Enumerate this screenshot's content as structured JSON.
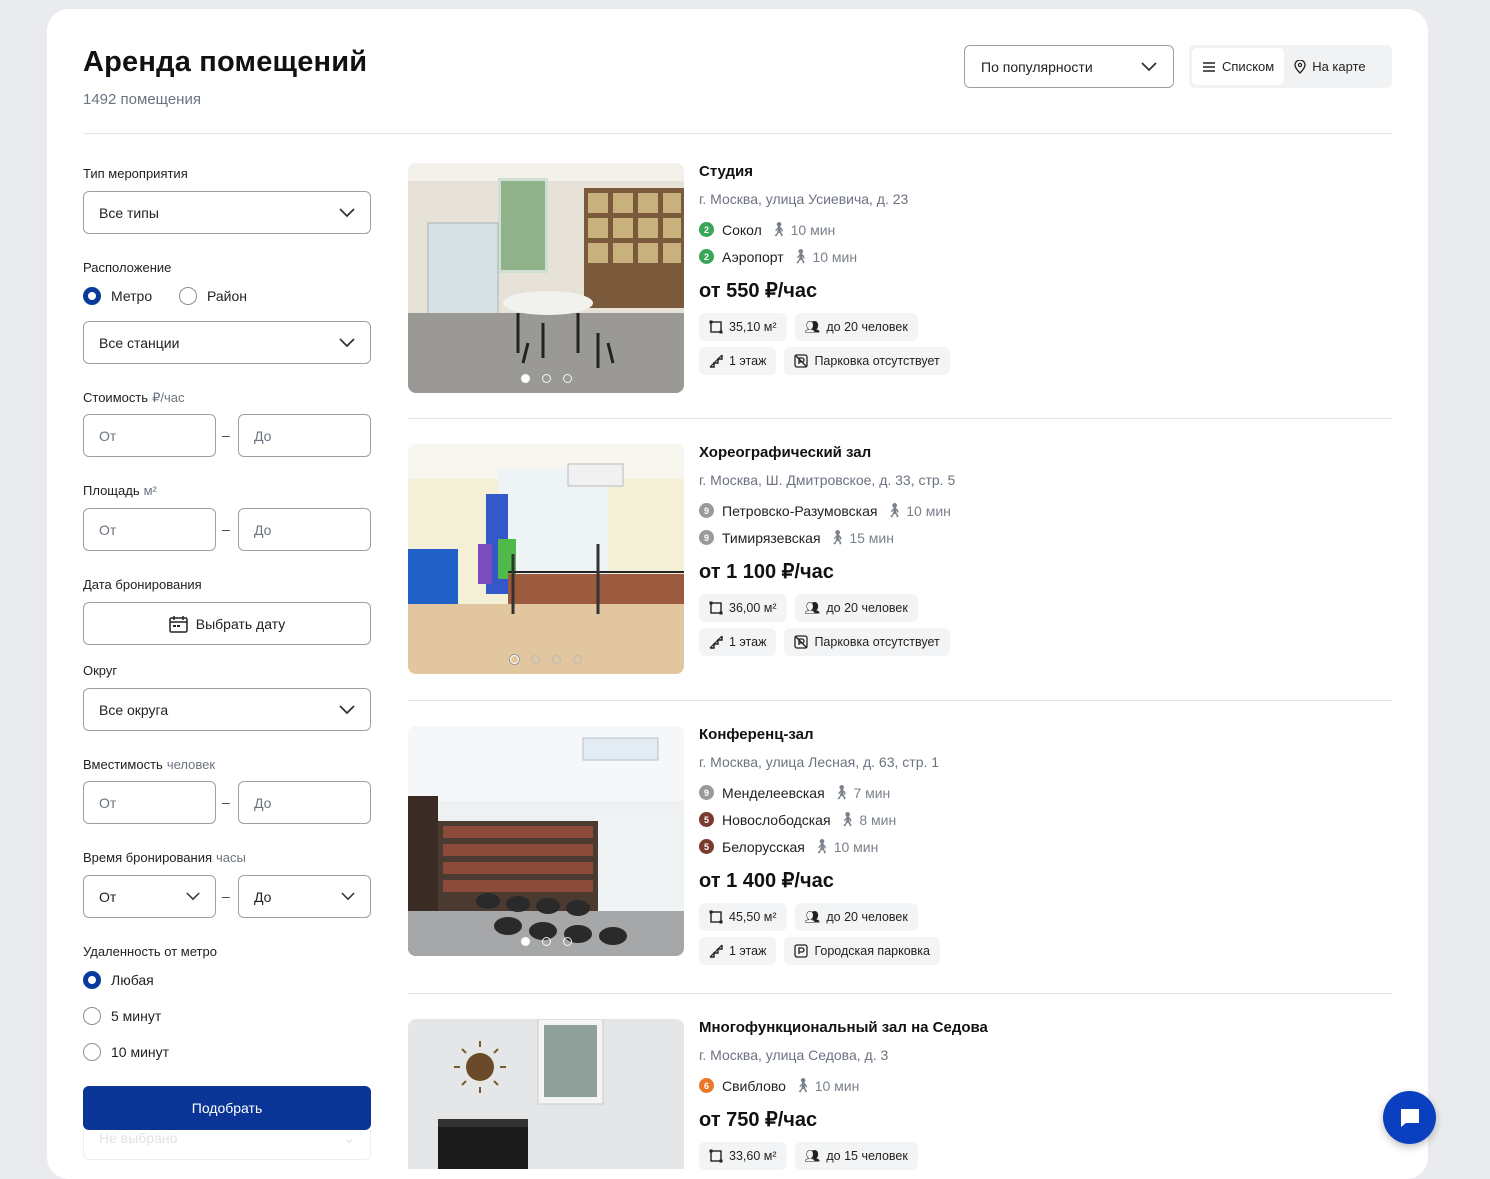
{
  "header": {
    "title": "Аренда помещений",
    "count": "1492 помещения",
    "sort_label": "По популярности",
    "view_list": "Списком",
    "view_map": "На карте"
  },
  "filters": {
    "event_type": {
      "label": "Тип мероприятия",
      "value": "Все типы"
    },
    "location": {
      "label": "Расположение",
      "opt_metro": "Метро",
      "opt_district": "Район",
      "selected": "Метро",
      "station_value": "Все станции"
    },
    "cost": {
      "label": "Стоимость",
      "hint": "₽/час",
      "from": "От",
      "to": "До"
    },
    "area": {
      "label": "Площадь",
      "hint": "м²",
      "from": "От",
      "to": "До"
    },
    "date": {
      "label": "Дата бронирования",
      "button": "Выбрать дату"
    },
    "okrug": {
      "label": "Округ",
      "value": "Все округа"
    },
    "capacity": {
      "label": "Вместимость",
      "hint": "человек",
      "from": "От",
      "to": "До"
    },
    "time": {
      "label": "Время бронирования",
      "hint": "часы",
      "from": "От",
      "to": "До"
    },
    "distance": {
      "label": "Удаленность от метро",
      "options": [
        "Любая",
        "5 минут",
        "10 минут"
      ],
      "selected": "Любая"
    },
    "submit": "Подобрать",
    "ghost_value": "Не выбрано"
  },
  "listings": [
    {
      "name": "Студия",
      "address": "г. Москва, улица Усиевича, д. 23",
      "metro": [
        {
          "line": "2",
          "color": "#3aa657",
          "station": "Сокол",
          "walk": "10 мин"
        },
        {
          "line": "2",
          "color": "#3aa657",
          "station": "Аэропорт",
          "walk": "10 мин"
        }
      ],
      "price": "от 550 ₽/час",
      "area": "35,10 м²",
      "capacity": "до 20 человек",
      "floor": "1 этаж",
      "parking": "Парковка отсутствует",
      "photos": 3,
      "active_photo": 1
    },
    {
      "name": "Хореографический зал",
      "address": "г. Москва, Ш. Дмитровское, д. 33, стр. 5",
      "metro": [
        {
          "line": "9",
          "color": "#9a9a9a",
          "station": "Петровско-Разумовская",
          "walk": "10 мин"
        },
        {
          "line": "9",
          "color": "#9a9a9a",
          "station": "Тимирязевская",
          "walk": "15 мин"
        }
      ],
      "price": "от 1 100 ₽/час",
      "area": "36,00 м²",
      "capacity": "до 20 человек",
      "floor": "1 этаж",
      "parking": "Парковка отсутствует",
      "photos": 4,
      "active_photo": 1
    },
    {
      "name": "Конференц-зал",
      "address": "г. Москва, улица Лесная, д. 63, стр. 1",
      "metro": [
        {
          "line": "9",
          "color": "#9a9a9a",
          "station": "Менделеевская",
          "walk": "7 мин"
        },
        {
          "line": "5",
          "color": "#7a3b2e",
          "station": "Новослободская",
          "walk": "8 мин"
        },
        {
          "line": "5",
          "color": "#7a3b2e",
          "station": "Белорусская",
          "walk": "10 мин"
        }
      ],
      "price": "от 1 400 ₽/час",
      "area": "45,50 м²",
      "capacity": "до 20 человек",
      "floor": "1 этаж",
      "parking": "Городская парковка",
      "photos": 3,
      "active_photo": 1
    },
    {
      "name": "Многофункциональный зал на Седова",
      "address": "г. Москва, улица Седова, д. 3",
      "metro": [
        {
          "line": "6",
          "color": "#e9782b",
          "station": "Свиблово",
          "walk": "10 мин"
        }
      ],
      "price": "от 750 ₽/час",
      "area": "33,60 м²",
      "capacity": "до 15 человек"
    }
  ],
  "colors": {
    "accent": "#0a3596",
    "fab": "#0a3fbf"
  }
}
